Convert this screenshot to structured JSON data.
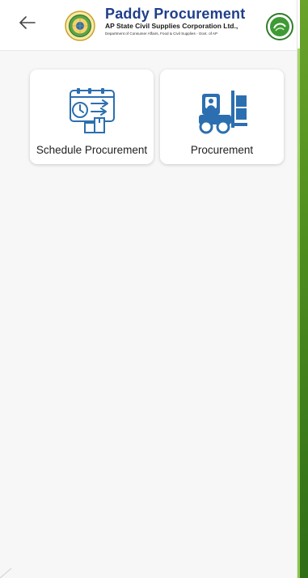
{
  "header": {
    "title": "Paddy Procurement",
    "subtitle": "AP State Civil Supplies Corporation Ltd.,",
    "department": "Department of Consumer Affairs, Food & Civil Supplies - Govt. of AP",
    "back_icon": "arrow-left-icon",
    "emblem_icon": "ap-emblem-icon",
    "seal_icon": "apscsc-seal-icon"
  },
  "tiles": [
    {
      "label": "Schedule Procurement",
      "icon": "schedule-calendar-clock-icon"
    },
    {
      "label": "Procurement",
      "icon": "forklift-icon"
    }
  ],
  "colors": {
    "brand_blue": "#1f3f8a",
    "icon_blue": "#2b6fb0",
    "accent_green": "#4f8f1f"
  }
}
